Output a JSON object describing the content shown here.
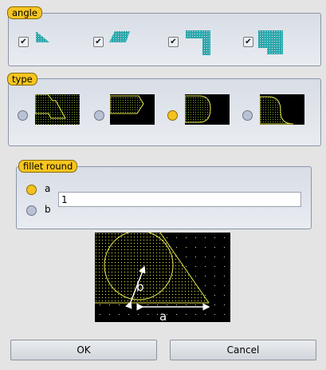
{
  "angle": {
    "title": "angle",
    "checked": [
      true,
      true,
      true,
      true
    ],
    "check_glyph": "✔"
  },
  "type": {
    "title": "type",
    "selected_index": 2
  },
  "fillet": {
    "title": "fillet round",
    "options": [
      "a",
      "b"
    ],
    "selected": "a",
    "value": "1"
  },
  "diagram": {
    "label_a": "a",
    "label_b": "b"
  },
  "buttons": {
    "ok": "OK",
    "cancel": "Cancel"
  },
  "colors": {
    "accent": "#f7c51e",
    "pattern": "#2aa8ac",
    "wire": "#e8e84a"
  }
}
